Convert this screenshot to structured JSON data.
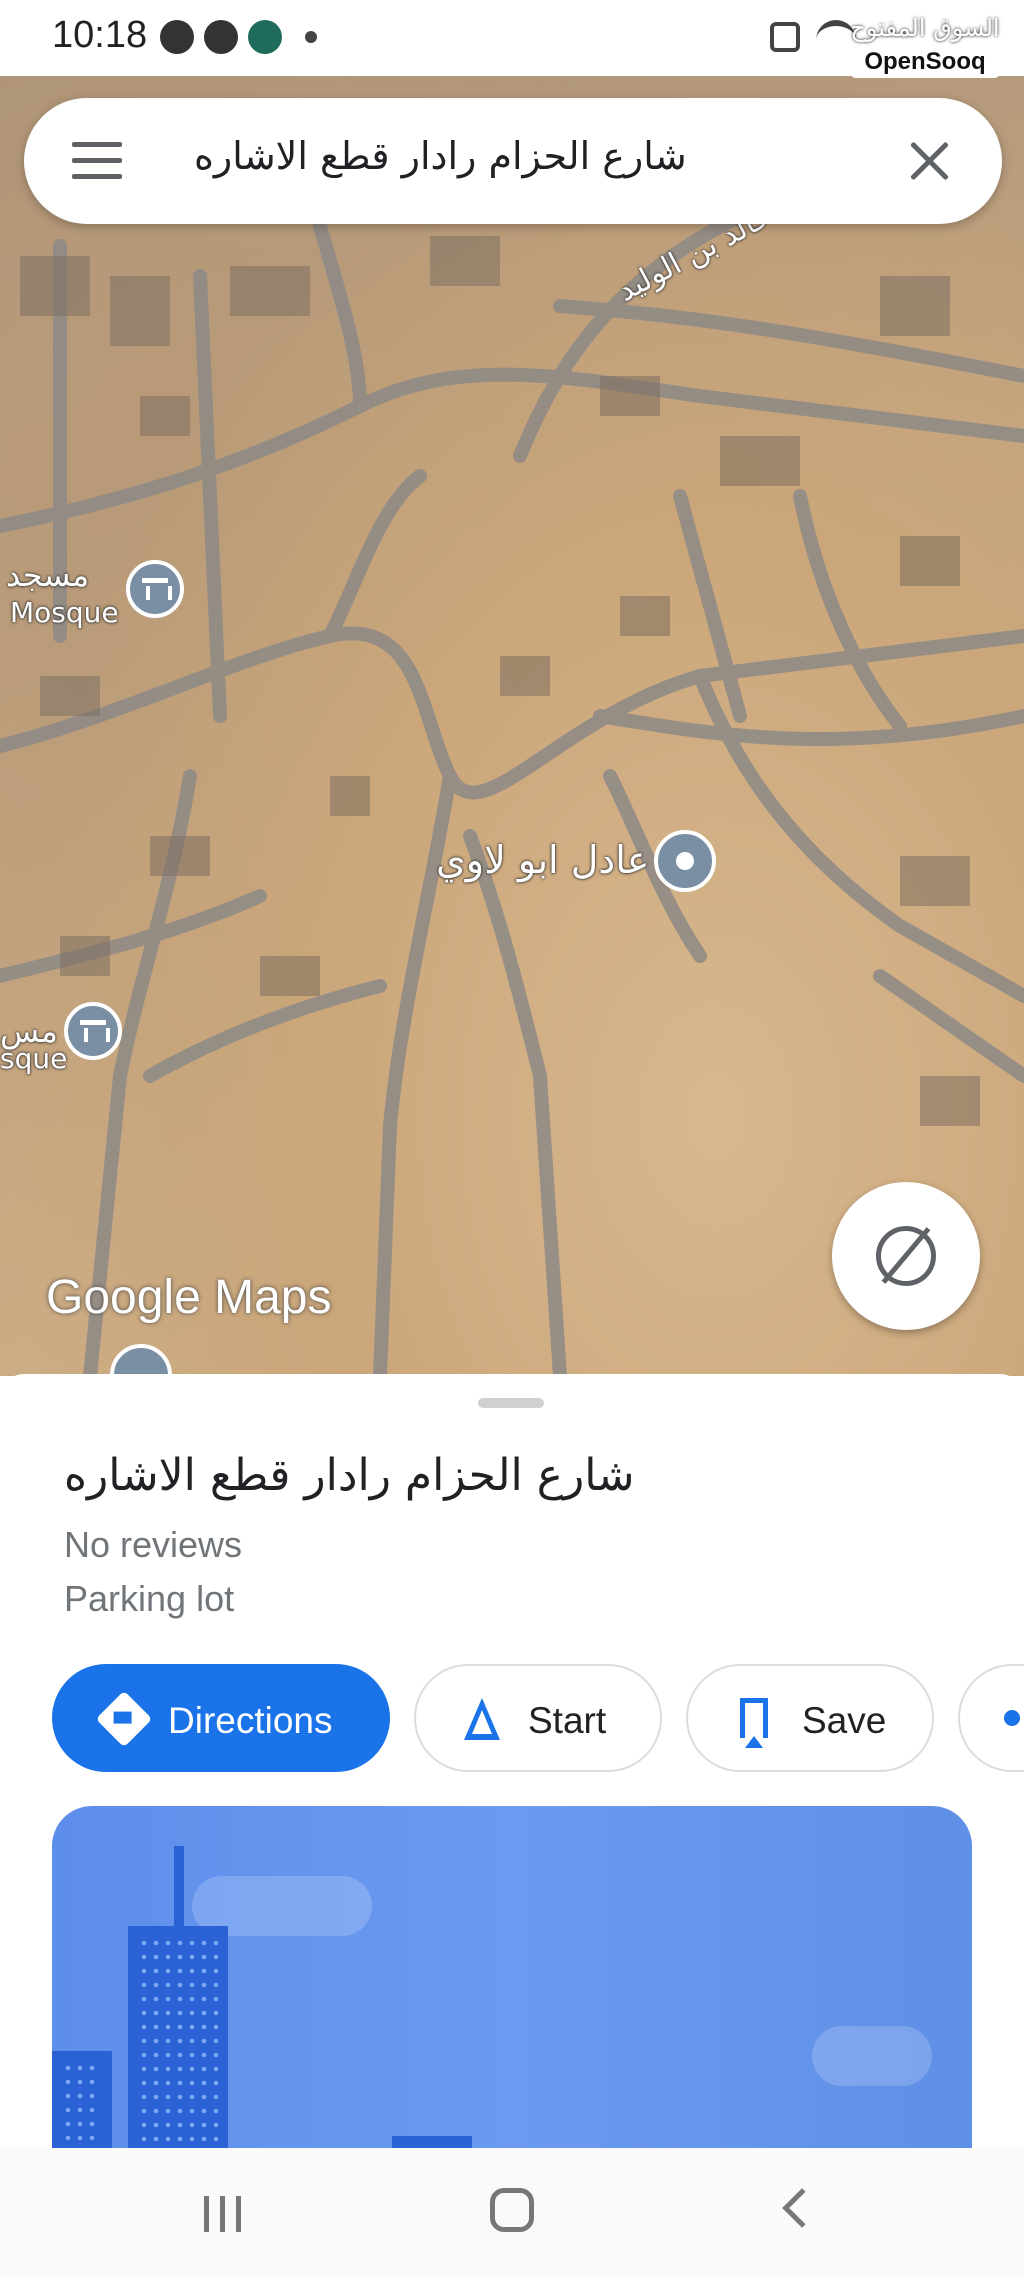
{
  "status_bar": {
    "time": "10:18"
  },
  "watermark": {
    "arabic": "السوق المفتوح",
    "english": "OpenSooq"
  },
  "search": {
    "query": "شارع الحزام رادار قطع الاشاره"
  },
  "map": {
    "mosque_label_ar": "مسجد",
    "mosque_label_en": "Mosque",
    "mosque2_label_ar": "مس",
    "mosque2_label_en": "sque",
    "place_label": "عادل ابو لاوي",
    "street_label": "خالد بن الوليد",
    "logo": "Google Maps"
  },
  "place": {
    "title": "شارع الحزام رادار قطع الاشاره",
    "reviews": "No reviews",
    "type": "Parking lot"
  },
  "actions": {
    "directions": "Directions",
    "start": "Start",
    "save": "Save"
  },
  "colors": {
    "accent": "#1a73e8"
  },
  "icons": [
    "menu-icon",
    "close-icon",
    "locate-icon",
    "directions-icon",
    "navigation-arrow-icon",
    "bookmark-icon",
    "share-icon",
    "mosque-icon"
  ]
}
